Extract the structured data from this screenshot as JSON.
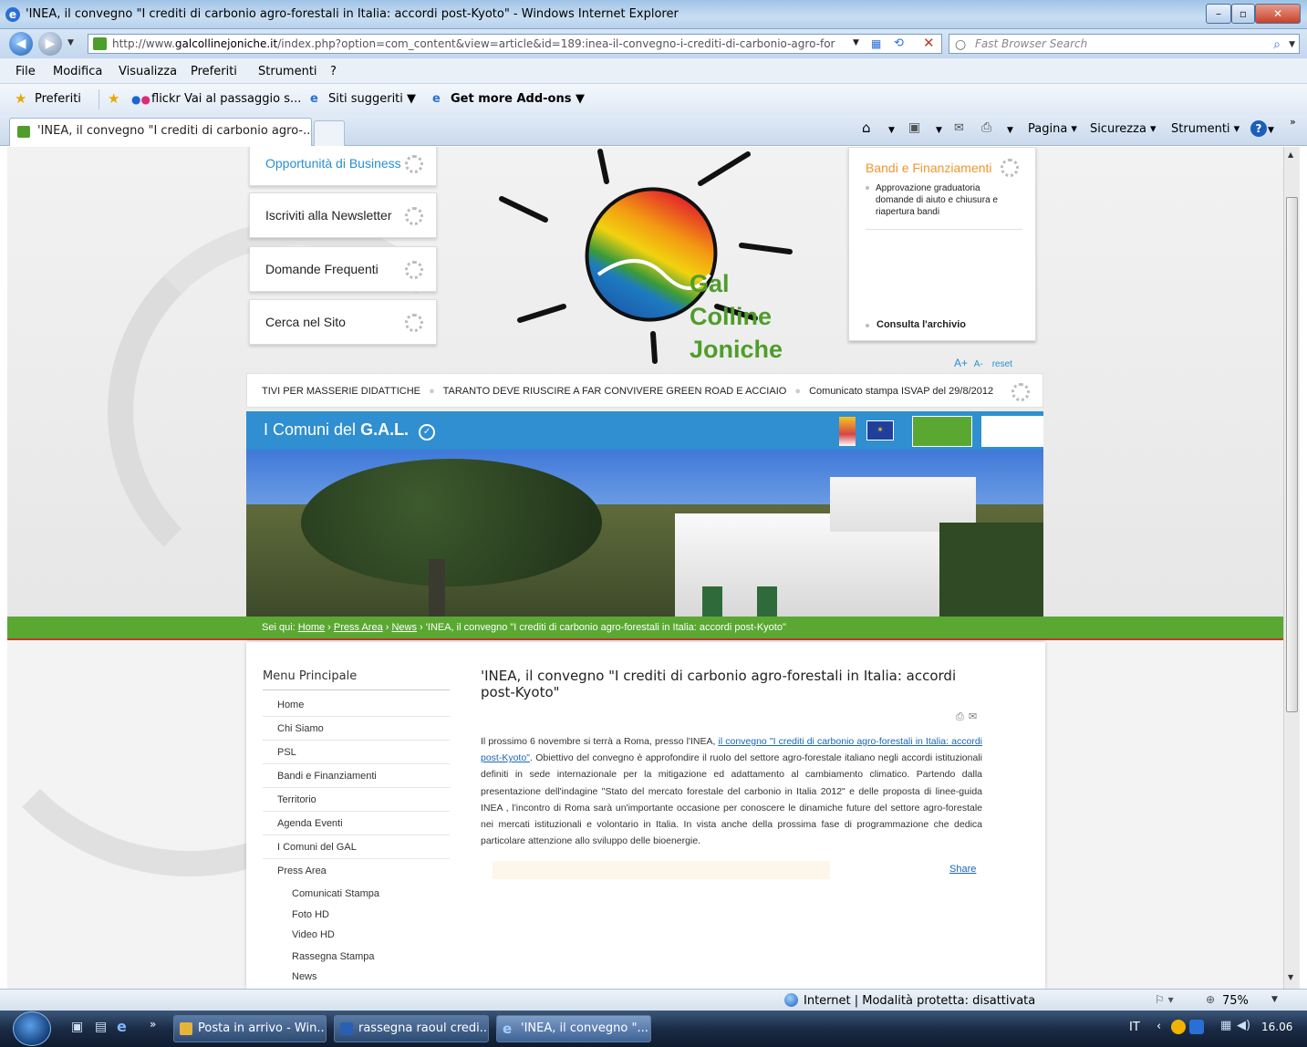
{
  "window": {
    "title": "'INEA, il convegno \"I crediti di carbonio agro-forestali in Italia: accordi post-Kyoto\" - Windows Internet Explorer"
  },
  "addressbar": {
    "url_prefix": "http://www.",
    "url_domain": "galcollinejoniche.it",
    "url_rest": "/index.php?option=com_content&view=article&id=189:inea-il-convegno-i-crediti-di-carbonio-agro-for",
    "search_placeholder": "Fast Browser Search"
  },
  "menubar": [
    "File",
    "Modifica",
    "Visualizza",
    "Preferiti",
    "Strumenti",
    "?"
  ],
  "favorites": {
    "preferiti": "Preferiti",
    "flickr": "flickr Vai al passaggio s...",
    "siti": "Siti suggeriti ▼",
    "addons": "Get more Add-ons ▼"
  },
  "tab": {
    "label": "'INEA, il convegno \"I crediti di carbonio agro-..."
  },
  "commandbar": {
    "pagina": "Pagina ▾",
    "sicurezza": "Sicurezza ▾",
    "strumenti": "Strumenti ▾"
  },
  "site": {
    "left_boxes": [
      "Opportunità di Business",
      "Iscriviti alla Newsletter",
      "Domande Frequenti",
      "Cerca nel Sito"
    ],
    "logo_lines": [
      "Gal",
      "Colline",
      "Joniche"
    ],
    "bandi": {
      "title": "Bandi e Finanziamenti",
      "item": "Approvazione graduatoria domande di aiuto e chiusura e riapertura bandi",
      "archive": "Consulta l'archivio"
    },
    "font_controls": {
      "plus": "A+",
      "minus": "A-",
      "reset": "reset"
    },
    "ticker": [
      "TIVI PER MASSERIE DIDATTICHE",
      "TARANTO DEVE RIUSCIRE A FAR CONVIVERE GREEN ROAD E ACCIAIO",
      "Comunicato stampa ISVAP del 29/8/2012"
    ],
    "comuni_label_a": "I Comuni del ",
    "comuni_label_b": "G.A.L.",
    "breadcrumb": {
      "prefix": "Sei qui:",
      "home": "Home",
      "press": "Press Area",
      "news": "News",
      "current": "'INEA, il convegno \"I crediti di carbonio agro-forestali in Italia: accordi post-Kyoto\""
    },
    "menu_title": "Menu Principale",
    "menu_items": [
      "Home",
      "Chi Siamo",
      "PSL",
      "Bandi e Finanziamenti",
      "Territorio",
      "Agenda Eventi",
      "I Comuni del GAL",
      "Press Area"
    ],
    "submenu_items": [
      "Comunicati Stampa",
      "Foto HD",
      "Video HD",
      "Rassegna Stampa",
      "News"
    ],
    "article": {
      "title": "'INEA, il convegno \"I crediti di carbonio agro-forestali in Italia: accordi post-Kyoto\"",
      "body_start": "Il prossimo 6 novembre si terrà a Roma, presso l'INEA, ",
      "body_link": "il convegno \"I crediti di carbonio agro-forestali in Italia: accordi post-Kyoto\"",
      "body_rest": ". Obiettivo del convegno è approfondire il ruolo del settore agro-forestale italiano negli accordi istituzionali definiti in sede internazionale per la mitigazione ed adattamento al cambiamento climatico. Partendo dalla presentazione dell'indagine \"Stato del mercato forestale del carbonio in Italia 2012\" e delle proposta di linee-guida INEA , l'incontro di Roma sarà un'importante occasione per conoscere le dinamiche future del settore agro-forestale nei mercati istituzionali e volontario in Italia. In vista anche della prossima fase di programmazione che dedica particolare attenzione allo sviluppo delle bioenergie.",
      "share": "Share"
    }
  },
  "statusbar": {
    "zone": "Internet | Modalità protetta: disattivata",
    "zoom": "75%"
  },
  "taskbar": {
    "tasks": [
      "Posta in arrivo - Win...",
      "rassegna raoul credi...",
      "'INEA, il convegno \"..."
    ],
    "lang": "IT",
    "clock": "16.06"
  }
}
